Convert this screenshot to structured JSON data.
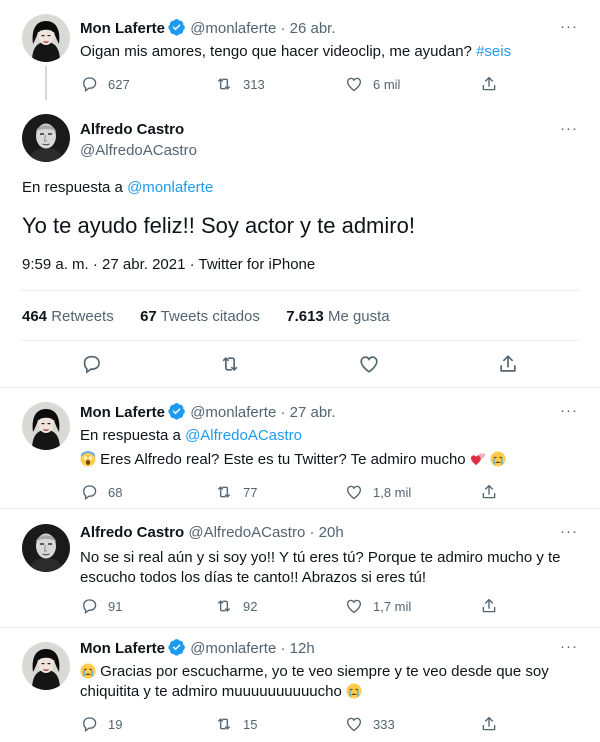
{
  "tweet1": {
    "name": "Mon Laferte",
    "handle": "@monlaferte",
    "sep": "·",
    "time": "26 abr.",
    "text_before": "Oigan mis amores, tengo que hacer videoclip, me ayudan? ",
    "hashtag": "#seis",
    "replies": "627",
    "retweets": "313",
    "likes": "6 mil"
  },
  "main": {
    "name": "Alfredo Castro",
    "handle": "@AlfredoACastro",
    "reply_prefix": "En respuesta a ",
    "reply_to": "@monlaferte",
    "text": "Yo te ayudo feliz!! Soy actor y te admiro!",
    "timestamp": "9:59 a. m. · 27 abr. 2021 · Twitter for iPhone",
    "stats": {
      "retweets_count": "464",
      "retweets_label": " Retweets",
      "quotes_count": "67",
      "quotes_label": " Tweets citados",
      "likes_count": "7.613",
      "likes_label": " Me gusta"
    }
  },
  "tweet3": {
    "name": "Mon Laferte",
    "handle": "@monlaferte",
    "sep": "·",
    "time": "27 abr.",
    "reply_prefix": "En respuesta a ",
    "reply_to": "@AlfredoACastro",
    "text": "Eres Alfredo real? Este es tu Twitter? Te admiro mucho",
    "replies": "68",
    "retweets": "77",
    "likes": "1,8 mil"
  },
  "tweet4": {
    "name": "Alfredo Castro",
    "handle": "@AlfredoACastro",
    "sep": "·",
    "time": "20h",
    "text_line1": "No se si real aún y si soy yo!! Y tú eres tú? Porque te admiro mucho y te",
    "text_line2": "escucho todos los días te canto!! Abrazos si eres tú!",
    "replies": "91",
    "retweets": "92",
    "likes": "1,7 mil"
  },
  "tweet5": {
    "name": "Mon Laferte",
    "handle": "@monlaferte",
    "sep": "·",
    "time": "12h",
    "text_line1": "Gracias por escucharme, yo te veo siempre y te veo desde que soy",
    "text_line2": "chiquitita y te admiro muuuuuuuuuucho",
    "replies": "19",
    "retweets": "15",
    "likes": "333"
  },
  "more_menu": "···",
  "colors": {
    "accent": "#1d9bf0",
    "text": "#0f1419",
    "muted": "#536471",
    "border": "#eff3f4"
  },
  "icons": [
    "verified-badge-icon",
    "reply-icon",
    "retweet-icon",
    "like-icon",
    "share-icon",
    "scream-emoji-icon",
    "two-hearts-emoji-icon",
    "crying-emoji-icon"
  ]
}
